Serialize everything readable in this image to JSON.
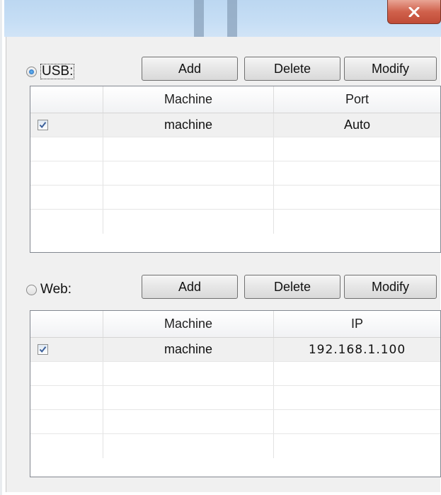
{
  "window": {
    "close_icon": "close-icon",
    "close_color": "#c9503b"
  },
  "usb": {
    "label": "USB:",
    "selected": true,
    "buttons": {
      "add": "Add",
      "delete": "Delete",
      "modify": "Modify"
    },
    "columns": [
      "",
      "Machine",
      "Port"
    ],
    "rows": [
      {
        "checked": true,
        "machine": "machine",
        "value": "Auto"
      }
    ]
  },
  "web": {
    "label": "Web:",
    "selected": false,
    "buttons": {
      "add": "Add",
      "delete": "Delete",
      "modify": "Modify"
    },
    "columns": [
      "",
      "Machine",
      "IP"
    ],
    "rows": [
      {
        "checked": true,
        "machine": "machine",
        "value": "192.168.1.100"
      }
    ]
  }
}
